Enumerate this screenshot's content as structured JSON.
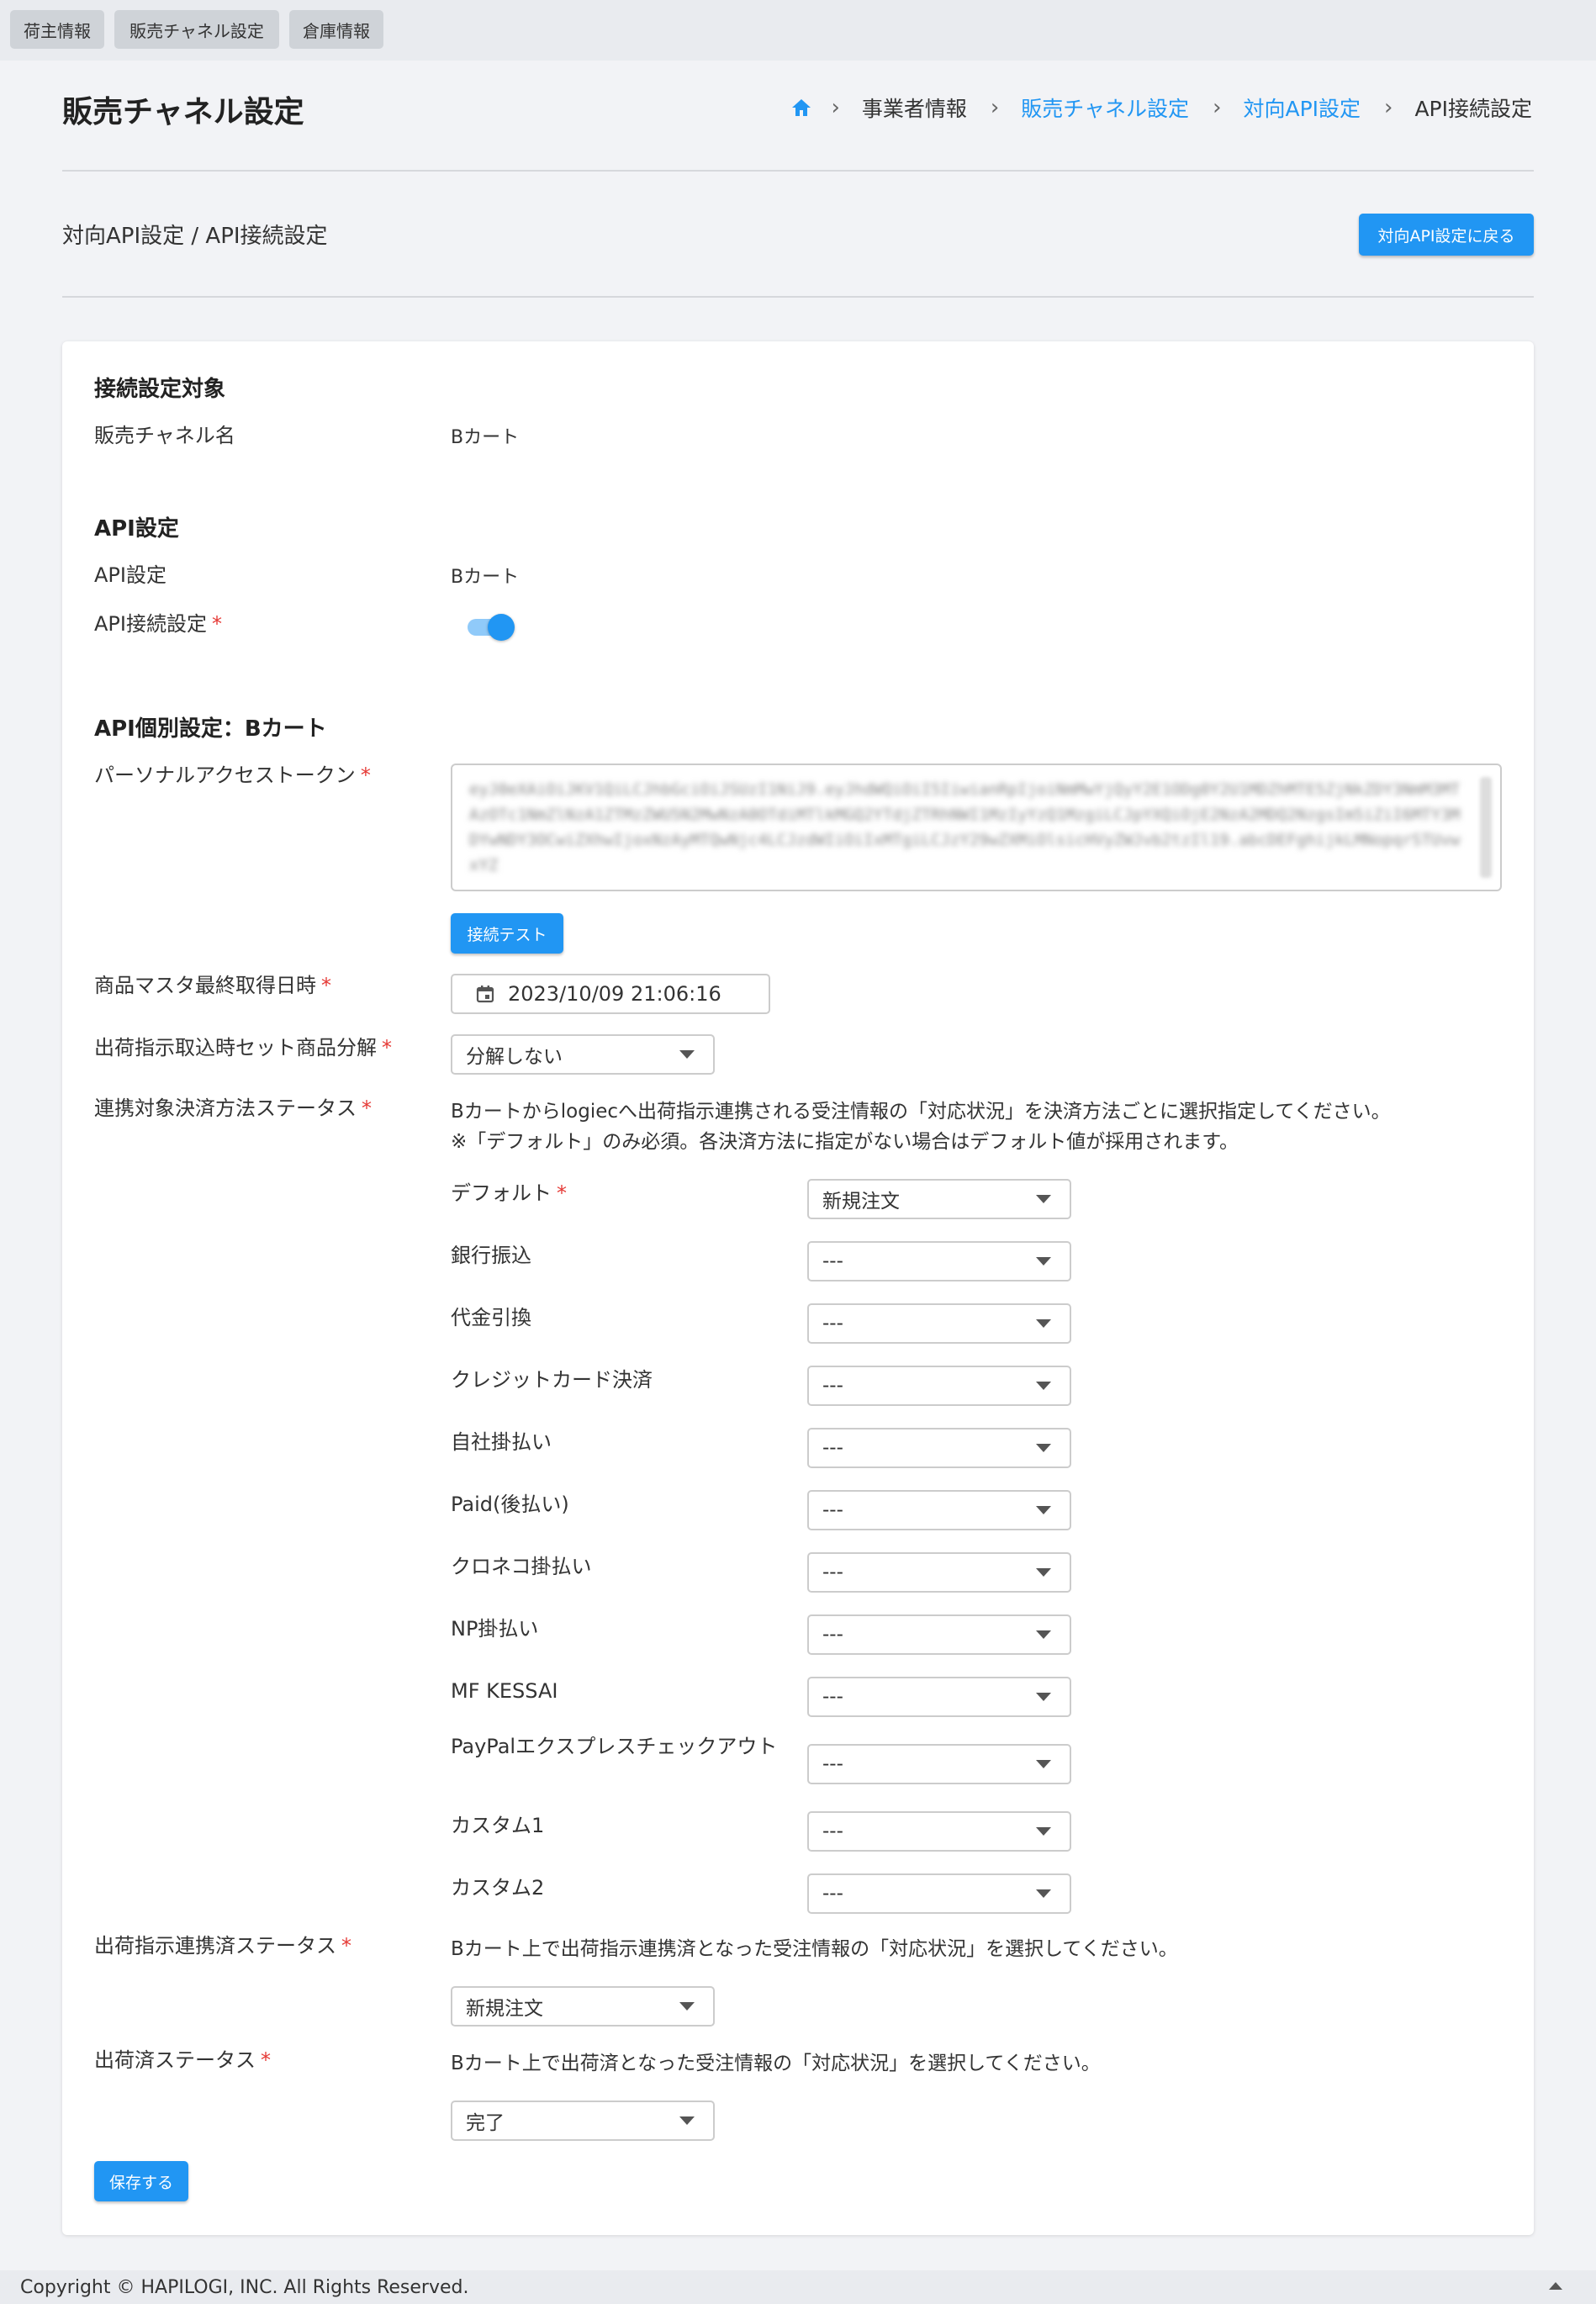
{
  "top_tabs": [
    "荷主情報",
    "販売チャネル設定",
    "倉庫情報"
  ],
  "header": {
    "title": "販売チャネル設定",
    "breadcrumb": [
      "事業者情報",
      "販売チャネル設定",
      "対向API設定",
      "API接続設定"
    ]
  },
  "subheader": {
    "title": "対向API設定 / API接続設定",
    "back_button": "対向API設定に戻る"
  },
  "target_section": {
    "title": "接続設定対象",
    "channel_name_label": "販売チャネル名",
    "channel_name_value": "Bカート"
  },
  "api_section": {
    "title": "API設定",
    "api_setting_label": "API設定",
    "api_setting_value": "Bカート",
    "api_connection_label": "API接続設定",
    "api_connection_enabled": true
  },
  "individual_section": {
    "title": "API個別設定：Bカート",
    "token_label": "パーソナルアクセストークン",
    "token_value": "eyJ0eXAiOiJKV1QiLCJhbGciOiJSUzI1NiJ9.eyJhdWQiOiI5IiwianRpIjoiNmMwYjQyY2E1ODg0Y2U1MDZhMTE5ZjNkZDY3NmM3MTAzOTc1NmZlNzA1ZTMzZWU5N2MwNzA0OTdiMTlkMGQ2YTdjZTRhNWI1MzIyYzQ1MzgiLCJpYXQiOjE2NzA2MDQ2NzgsIm5iZiI6MTY3MDYwNDY3OCwiZXhwIjoxNzAyMTQwNjc4LCJzdWIiOiIxMTgiLCJzY29wZXMiOlsicHVyZWJvb2tzIl19.abcDEFghijkLMNopqrSTUvwxYZ",
    "connection_test_button": "接続テスト",
    "product_master_label": "商品マスタ最終取得日時",
    "product_master_value": "2023/10/09 21:06:16",
    "set_decompose_label": "出荷指示取込時セット商品分解",
    "set_decompose_value": "分解しない",
    "payment_status_label": "連携対象決済方法ステータス",
    "payment_note_1": "Bカートからlogiecへ出荷指示連携される受注情報の「対応状況」を決済方法ごとに選択指定してください。",
    "payment_note_2": "※「デフォルト」のみ必須。各決済方法に指定がない場合はデフォルト値が採用されます。",
    "payment_methods": [
      {
        "label": "デフォルト",
        "value": "新規注文",
        "required": true
      },
      {
        "label": "銀行振込",
        "value": "---"
      },
      {
        "label": "代金引換",
        "value": "---"
      },
      {
        "label": "クレジットカード決済",
        "value": "---"
      },
      {
        "label": "自社掛払い",
        "value": "---"
      },
      {
        "label": "Paid(後払い)",
        "value": "---"
      },
      {
        "label": "クロネコ掛払い",
        "value": "---"
      },
      {
        "label": "NP掛払い",
        "value": "---"
      },
      {
        "label": "MF KESSAI",
        "value": "---"
      },
      {
        "label": "PayPalエクスプレスチェックアウト",
        "value": "---"
      },
      {
        "label": "カスタム1",
        "value": "---"
      },
      {
        "label": "カスタム2",
        "value": "---"
      }
    ],
    "linked_status_label": "出荷指示連携済ステータス",
    "linked_status_note": "Bカート上で出荷指示連携済となった受注情報の「対応状況」を選択してください。",
    "linked_status_value": "新規注文",
    "shipped_status_label": "出荷済ステータス",
    "shipped_status_note": "Bカート上で出荷済となった受注情報の「対応状況」を選択してください。",
    "shipped_status_value": "完了",
    "save_button": "保存する",
    "required_mark": "*"
  },
  "footer": {
    "copyright": "Copyright © HAPILOGI, INC. All Rights Reserved."
  },
  "colors": {
    "accent": "#2196f3",
    "required": "#e53935",
    "background": "#f2f3f6"
  }
}
